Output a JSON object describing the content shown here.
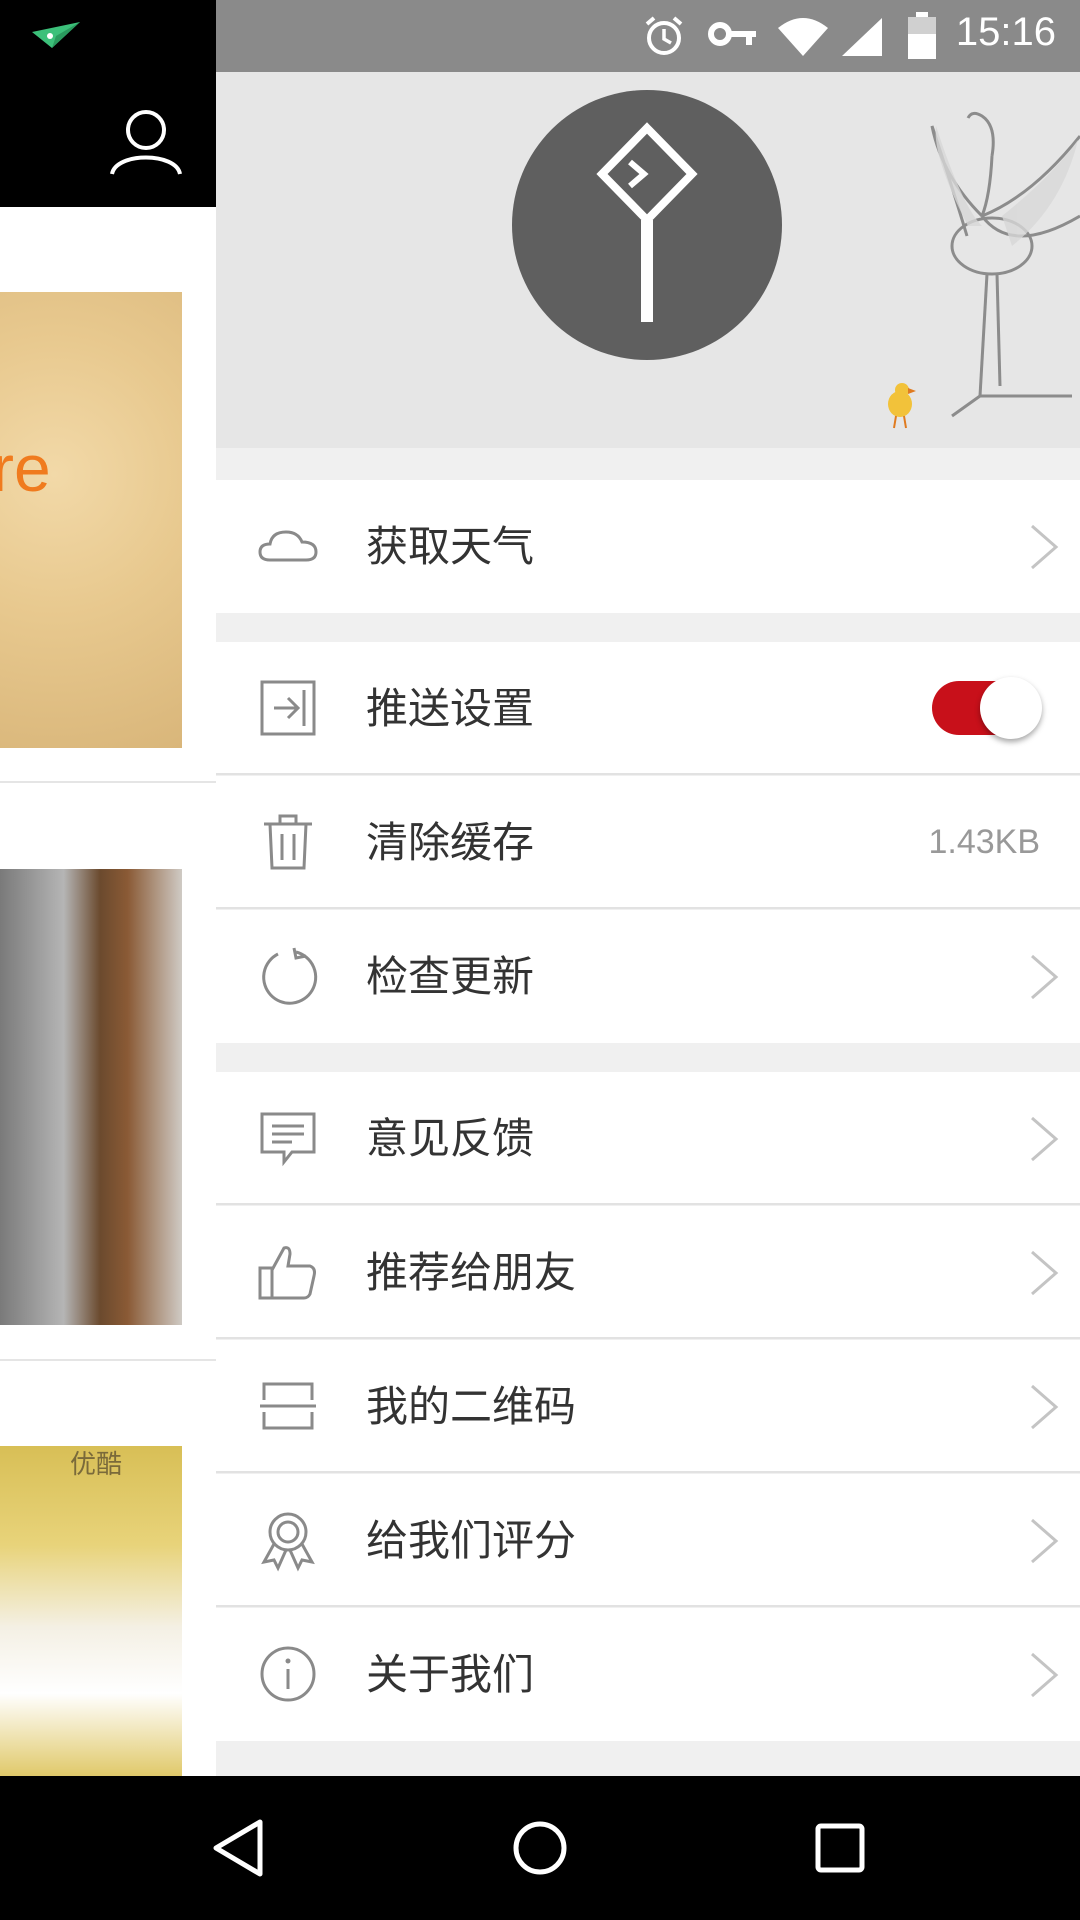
{
  "status_bar": {
    "time": "15:16",
    "icons": [
      "alarm-icon",
      "vpn-key-icon",
      "wifi-icon",
      "cell-signal-icon",
      "battery-icon"
    ]
  },
  "background_app": {
    "card_1_text": "re",
    "card_3_label": "优酷"
  },
  "drawer": {
    "menu": [
      {
        "id": "weather",
        "label": "获取天气",
        "icon": "cloud-icon",
        "trailing": "chevron"
      },
      {
        "id": "push",
        "label": "推送设置",
        "icon": "login-arrow-icon",
        "trailing": "toggle",
        "toggle_on": true
      },
      {
        "id": "cache",
        "label": "清除缓存",
        "icon": "trash-icon",
        "trailing": "value",
        "value": "1.43KB"
      },
      {
        "id": "update",
        "label": "检查更新",
        "icon": "refresh-icon",
        "trailing": "chevron"
      },
      {
        "id": "feedback",
        "label": "意见反馈",
        "icon": "chat-bubble-icon",
        "trailing": "chevron"
      },
      {
        "id": "recommend",
        "label": "推荐给朋友",
        "icon": "thumbs-up-icon",
        "trailing": "chevron"
      },
      {
        "id": "qrcode",
        "label": "我的二维码",
        "icon": "qr-frame-icon",
        "trailing": "chevron"
      },
      {
        "id": "rate",
        "label": "给我们评分",
        "icon": "award-badge-icon",
        "trailing": "chevron"
      },
      {
        "id": "about",
        "label": "关于我们",
        "icon": "info-icon",
        "trailing": "chevron"
      }
    ]
  },
  "colors": {
    "toggle_on": "#c8101a",
    "status_bar": "#8a8a8a",
    "avatar": "#5f5f5f"
  },
  "nav_bar": {
    "buttons": [
      "back-icon",
      "home-icon",
      "recents-icon"
    ]
  }
}
